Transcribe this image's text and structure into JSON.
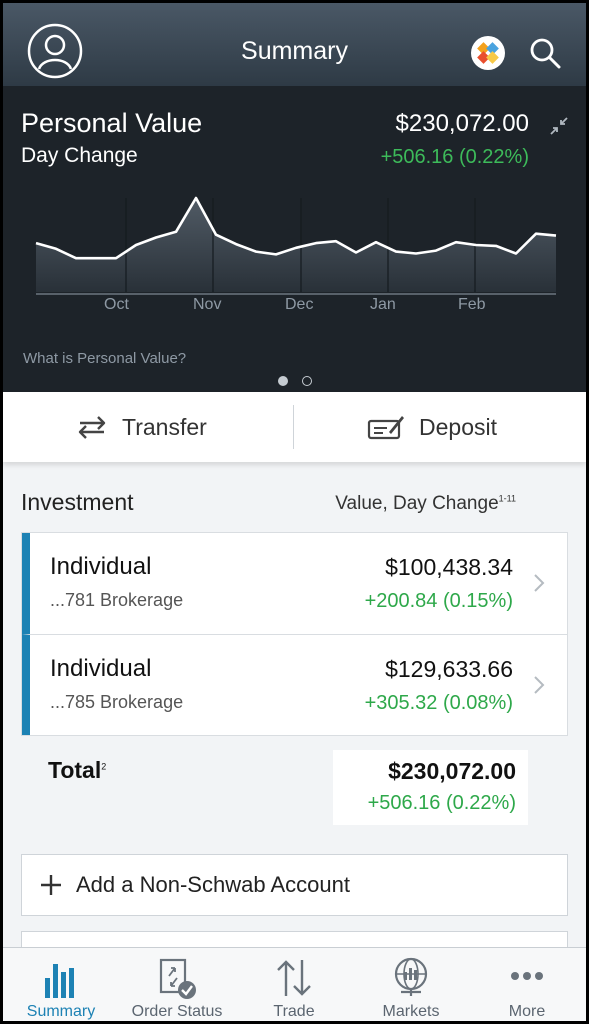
{
  "header": {
    "title": "Summary"
  },
  "personal_value": {
    "label": "Personal Value",
    "value": "$230,072.00",
    "day_change_label": "Day Change",
    "day_change_value": "+506.16 (0.22%)",
    "months": [
      "Oct",
      "Nov",
      "Dec",
      "Jan",
      "Feb"
    ],
    "link": "What is Personal Value?",
    "chart_data": {
      "type": "area",
      "x_labels": [
        "Oct",
        "Nov",
        "Dec",
        "Jan",
        "Feb"
      ],
      "values": [
        0.52,
        0.46,
        0.36,
        0.36,
        0.36,
        0.5,
        0.58,
        0.64,
        1.0,
        0.61,
        0.51,
        0.43,
        0.4,
        0.47,
        0.52,
        0.54,
        0.42,
        0.53,
        0.43,
        0.41,
        0.44,
        0.53,
        0.5,
        0.49,
        0.41,
        0.62,
        0.6
      ],
      "grid": true
    }
  },
  "actions": {
    "transfer": "Transfer",
    "deposit": "Deposit"
  },
  "investment": {
    "title": "Investment",
    "subtitle": "Value, Day Change",
    "subtitle_sup": "1-11",
    "accounts": [
      {
        "name": "Individual",
        "number": "...781  Brokerage",
        "value": "$100,438.34",
        "change": "+200.84 (0.15%)"
      },
      {
        "name": "Individual",
        "number": "...785  Brokerage",
        "value": "$129,633.66",
        "change": "+305.32 (0.08%)"
      }
    ],
    "total_label": "Total",
    "total_sup": "2",
    "total_value": "$230,072.00",
    "total_change": "+506.16 (0.22%)"
  },
  "add_account": "Add a Non-Schwab Account",
  "tabs": [
    {
      "label": "Summary",
      "icon": "bar-chart-icon",
      "active": true
    },
    {
      "label": "Order Status",
      "icon": "order-status-icon",
      "active": false
    },
    {
      "label": "Trade",
      "icon": "trade-arrows-icon",
      "active": false
    },
    {
      "label": "Markets",
      "icon": "globe-chart-icon",
      "active": false
    },
    {
      "label": "More",
      "icon": "more-dots-icon",
      "active": false
    }
  ],
  "colors": {
    "accent": "#1d82b4",
    "positive": "#2ea84a",
    "header_bg": "#3a4753",
    "chart_bg": "#1d2329"
  }
}
